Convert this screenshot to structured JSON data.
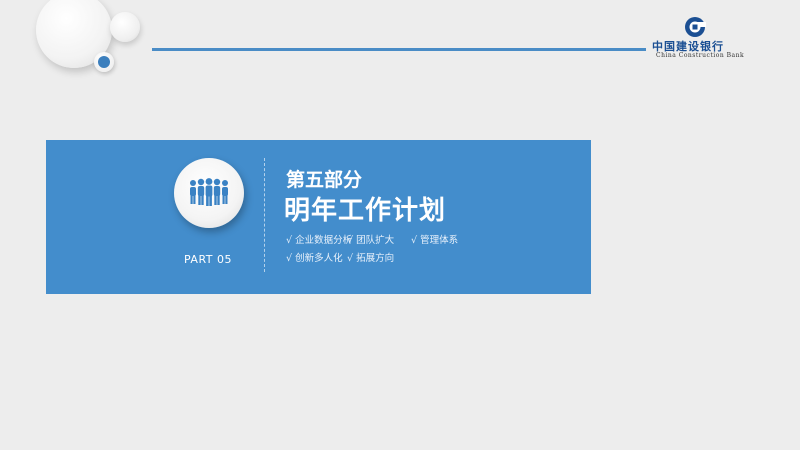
{
  "slide": {
    "part_label": "PART 05",
    "subtitle": "第五部分",
    "title": "明年工作计划",
    "points": [
      "√ 企业数据分析",
      "√ 团队扩大",
      "√ 管理体系",
      "√ 创新多人化",
      "√ 拓展方向"
    ]
  },
  "logo": {
    "name_cn": "中国建设银行",
    "name_en": "China Construction Bank"
  },
  "colors": {
    "accent": "#438dcc",
    "line": "#4a8cc6",
    "background": "#ededed",
    "brand": "#1b4f93"
  },
  "icons": {
    "people": "people-group-icon",
    "logo": "bank-logo-icon"
  }
}
